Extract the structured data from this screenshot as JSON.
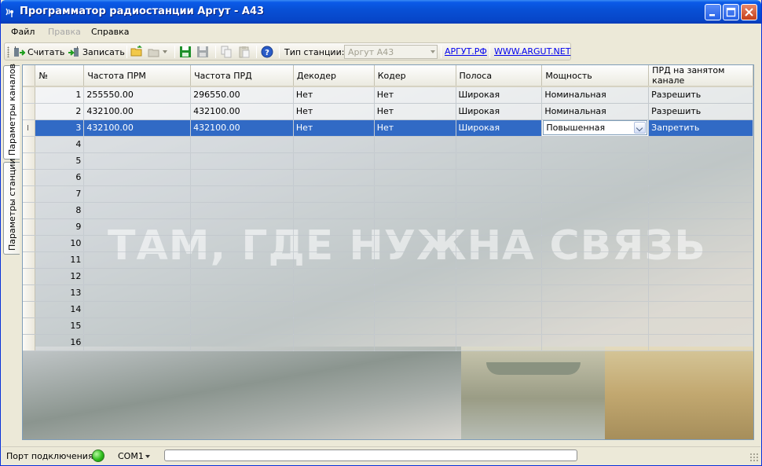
{
  "window": {
    "title": "Программатор радиостанции Аргут - А43"
  },
  "menu": {
    "items": [
      {
        "label": "Файл",
        "disabled": false
      },
      {
        "label": "Правка",
        "disabled": true
      },
      {
        "label": "Справка",
        "disabled": false
      }
    ]
  },
  "toolbar": {
    "read_label": "Считать",
    "write_label": "Записать",
    "station_type_label": "Тип станции:",
    "station_type_value": "Аргут А43",
    "link1": "АРГУТ.РФ",
    "link2": "WWW.ARGUT.NET"
  },
  "tabs": {
    "channels": "Параметры каналов",
    "station": "Параметры станции"
  },
  "background": {
    "slogan": "ТАМ, ГДЕ НУЖНА СВЯЗЬ"
  },
  "grid": {
    "columns": [
      "№",
      "Частота ПРМ",
      "Частота ПРД",
      "Декодер",
      "Кодер",
      "Полоса",
      "Мощность",
      "ПРД на занятом канале"
    ],
    "rows": [
      {
        "num": "1",
        "rx": "255550.00",
        "tx": "296550.00",
        "decoder": "Нет",
        "coder": "Нет",
        "band": "Широкая",
        "power": "Номинальная",
        "busy": "Разрешить"
      },
      {
        "num": "2",
        "rx": "432100.00",
        "tx": "432100.00",
        "decoder": "Нет",
        "coder": "Нет",
        "band": "Широкая",
        "power": "Номинальная",
        "busy": "Разрешить"
      },
      {
        "num": "3",
        "rx": "432100.00",
        "tx": "432100.00",
        "decoder": "Нет",
        "coder": "Нет",
        "band": "Широкая",
        "power": "Повышенная",
        "busy": "Запретить"
      }
    ],
    "empty_rows": [
      "4",
      "5",
      "6",
      "7",
      "8",
      "9",
      "10",
      "11",
      "12",
      "13",
      "14",
      "15",
      "16"
    ],
    "row_cursor": "I"
  },
  "status": {
    "port_label": "Порт подключения",
    "port_value": "COM1"
  },
  "colors": {
    "selection": "#316ac5",
    "titlebar": "#0a5ae8",
    "connected_led": "#2fbe1c"
  }
}
